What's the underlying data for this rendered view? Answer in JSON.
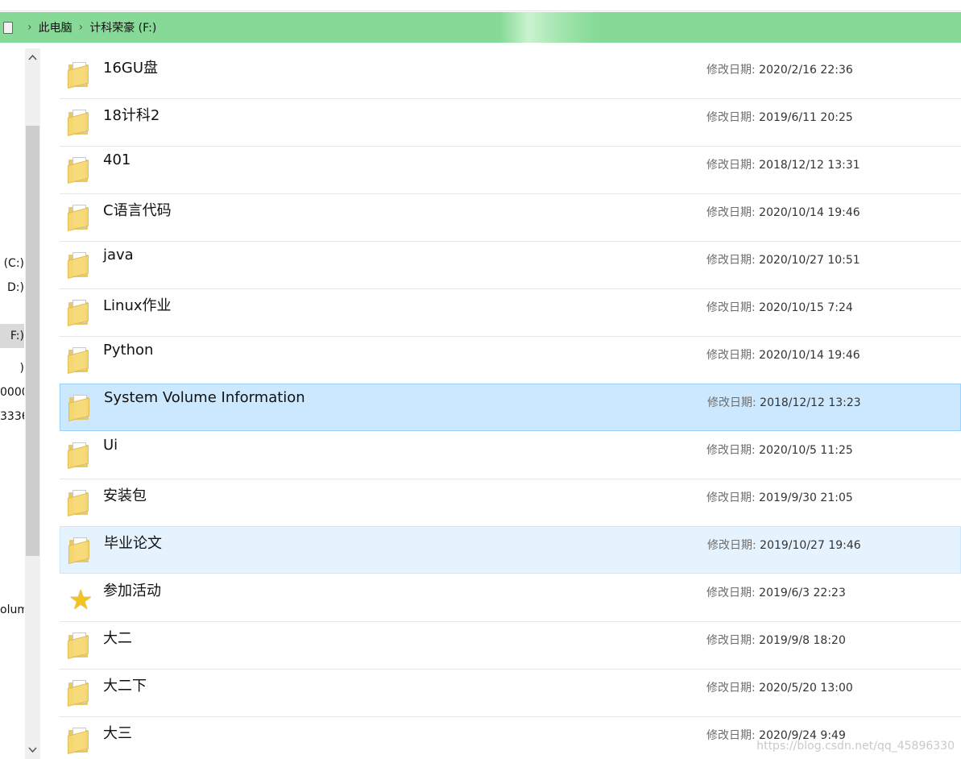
{
  "breadcrumb": {
    "items": [
      "此电脑",
      "计科荣豪 (F:)"
    ]
  },
  "nav_pane": {
    "items": [
      {
        "label": "(C:)",
        "selected": false
      },
      {
        "label": "D:)",
        "selected": false
      },
      {
        "label": "F:)",
        "selected": true
      },
      {
        "label": ")",
        "selected": false
      },
      {
        "label": "0000",
        "selected": false
      },
      {
        "label": "3336",
        "selected": false
      },
      {
        "label": "olum",
        "selected": false
      }
    ]
  },
  "files": {
    "date_label": "修改日期: ",
    "rows": [
      {
        "name": "16GU盘",
        "date": "2020/2/16 22:36",
        "icon": "folder-icon",
        "state": ""
      },
      {
        "name": "18计科2",
        "date": "2019/6/11 20:25",
        "icon": "folder-icon",
        "state": ""
      },
      {
        "name": "401",
        "date": "2018/12/12 13:31",
        "icon": "folder-icon",
        "state": ""
      },
      {
        "name": "C语言代码",
        "date": "2020/10/14 19:46",
        "icon": "folder-icon",
        "state": ""
      },
      {
        "name": "java",
        "date": "2020/10/27 10:51",
        "icon": "folder-icon",
        "state": ""
      },
      {
        "name": "Linux作业",
        "date": "2020/10/15 7:24",
        "icon": "folder-icon",
        "state": ""
      },
      {
        "name": "Python",
        "date": "2020/10/14 19:46",
        "icon": "folder-icon",
        "state": ""
      },
      {
        "name": "System Volume Information",
        "date": "2018/12/12 13:23",
        "icon": "folder-icon",
        "state": "selected"
      },
      {
        "name": "Ui",
        "date": "2020/10/5 11:25",
        "icon": "folder-icon",
        "state": ""
      },
      {
        "name": "安装包",
        "date": "2019/9/30 21:05",
        "icon": "folder-icon",
        "state": ""
      },
      {
        "name": "毕业论文",
        "date": "2019/10/27 19:46",
        "icon": "folder-icon",
        "state": "hover"
      },
      {
        "name": "参加活动",
        "date": "2019/6/3 22:23",
        "icon": "star-icon",
        "state": ""
      },
      {
        "name": "大二",
        "date": "2019/9/8 18:20",
        "icon": "folder-icon",
        "state": ""
      },
      {
        "name": "大二下",
        "date": "2020/5/20 13:00",
        "icon": "folder-icon",
        "state": ""
      },
      {
        "name": "大三",
        "date": "2020/9/24 9:49",
        "icon": "folder-icon",
        "state": ""
      }
    ]
  },
  "watermark": "https://blog.csdn.net/qq_45896330",
  "colors": {
    "address_bar": "#86d996",
    "selected_row": "#cce8ff",
    "hover_row": "#e5f3ff",
    "folder": "#f7d970"
  }
}
